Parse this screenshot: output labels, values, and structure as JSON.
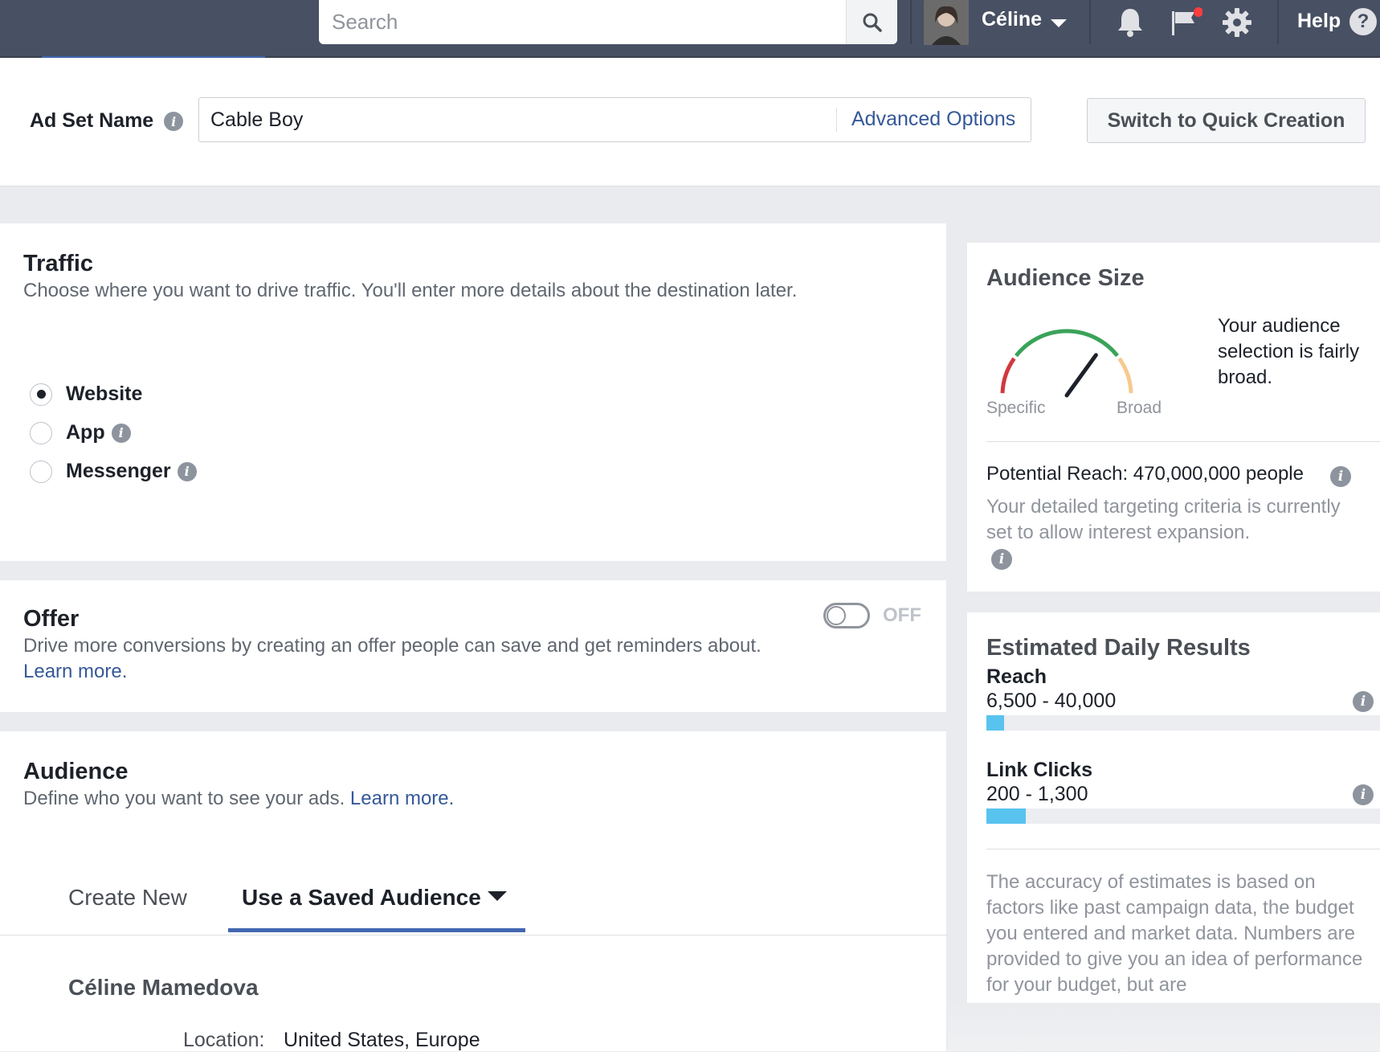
{
  "topbar": {
    "search_placeholder": "Search",
    "user_name": "Céline",
    "help_label": "Help",
    "help_icon": "?",
    "notification_dot_color": "#fa3e3e"
  },
  "adset": {
    "label": "Ad Set Name",
    "name_value": "Cable Boy",
    "advanced_options": "Advanced Options",
    "switch_button": "Switch to Quick Creation"
  },
  "traffic": {
    "title": "Traffic",
    "subtitle": "Choose where you want to drive traffic. You'll enter more details about the destination later.",
    "options": [
      {
        "label": "Website",
        "selected": true
      },
      {
        "label": "App",
        "selected": false
      },
      {
        "label": "Messenger",
        "selected": false
      }
    ]
  },
  "offer": {
    "title": "Offer",
    "subtitle": "Drive more conversions by creating an offer people can save and get reminders about.",
    "learn_more": "Learn more.",
    "toggle_state": "OFF"
  },
  "audience": {
    "title": "Audience",
    "subtitle": "Define who you want to see your ads.",
    "learn_more": "Learn more.",
    "tabs": [
      {
        "label": "Create New",
        "active": false
      },
      {
        "label": "Use a Saved Audience",
        "active": true
      }
    ],
    "saved_name": "Céline Mamedova",
    "location_label": "Location:",
    "location_value": "United States, Europe"
  },
  "audience_size": {
    "title": "Audience Size",
    "gauge_left": "Specific",
    "gauge_right": "Broad",
    "gauge_level": 0.7,
    "description": "Your audience selection is fairly broad.",
    "potential_reach": "Potential Reach: 470,000,000 people",
    "expansion_note": "Your detailed targeting criteria is currently set to allow interest expansion."
  },
  "daily_results": {
    "title": "Estimated Daily Results",
    "metrics": [
      {
        "label": "Reach",
        "value": "6,500 - 40,000",
        "fill_fraction": 0.045
      },
      {
        "label": "Link Clicks",
        "value": "200 - 1,300",
        "fill_fraction": 0.1
      }
    ],
    "note": "The accuracy of estimates is based on factors like past campaign data, the budget you entered and market data. Numbers are provided to give you an idea of performance for your budget, but are"
  },
  "colors": {
    "topbar": "#485063",
    "link": "#365899",
    "accent_tab": "#4267b2",
    "bar_fill": "#58c3ee",
    "gauge_red": "#d0393e",
    "gauge_green": "#3aa35a",
    "gauge_orange": "#f7c98f"
  }
}
